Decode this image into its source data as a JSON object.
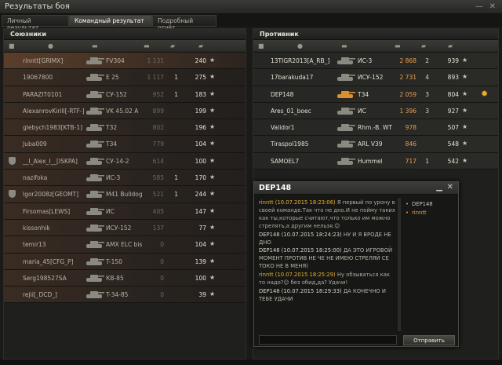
{
  "window": {
    "title": "Результаты боя",
    "min_symbol": "—",
    "close_symbol": "✕"
  },
  "tabs": [
    {
      "label": "Личный результат",
      "active": false
    },
    {
      "label": "Командный результат",
      "active": true
    },
    {
      "label": "Подробный отчёт",
      "active": false
    }
  ],
  "allies": {
    "title": "Союзники",
    "rows": [
      {
        "player": "rinntt[GRIMX]",
        "tank": "FV304",
        "damage": "1 131",
        "frags": "",
        "xp": "240",
        "highlight": true
      },
      {
        "player": "19067800",
        "tank": "E 25",
        "damage": "1 117",
        "frags": "1",
        "xp": "275"
      },
      {
        "player": "PARAZIT0101",
        "tank": "СУ-152",
        "damage": "952",
        "frags": "1",
        "xp": "183"
      },
      {
        "player": "AlexanrovKirill[-RTF-]",
        "tank": "VK 45.02 A",
        "damage": "899",
        "frags": "",
        "xp": "199"
      },
      {
        "player": "glebych1983[KTB-1]",
        "tank": "T32",
        "damage": "802",
        "frags": "",
        "xp": "196"
      },
      {
        "player": "Juba009",
        "tank": "T34",
        "damage": "779",
        "frags": "",
        "xp": "104"
      },
      {
        "player": "__I_Alex_I__[ISKPA]",
        "tank": "СУ-14-2",
        "damage": "614",
        "frags": "",
        "xp": "100",
        "clan_icon": true
      },
      {
        "player": "nazifoka",
        "tank": "ИС-3",
        "damage": "585",
        "frags": "1",
        "xp": "170"
      },
      {
        "player": "Igor2008z[GEOMT]",
        "tank": "M41 Bulldog",
        "damage": "521",
        "frags": "1",
        "xp": "244",
        "clan_icon": true
      },
      {
        "player": "Firsomas[LEWS]",
        "tank": "ИС",
        "damage": "405",
        "frags": "",
        "xp": "147"
      },
      {
        "player": "kissonhik",
        "tank": "ИСУ-152",
        "damage": "137",
        "frags": "",
        "xp": "77"
      },
      {
        "player": "temir13",
        "tank": "AMX ELC bis",
        "damage": "0",
        "frags": "",
        "xp": "104"
      },
      {
        "player": "maria_45[CFG_P]",
        "tank": "T-150",
        "damage": "0",
        "frags": "",
        "xp": "139"
      },
      {
        "player": "Serg198527SA",
        "tank": "КВ-85",
        "damage": "0",
        "frags": "",
        "xp": "100"
      },
      {
        "player": "rejii[_DCD_]",
        "tank": "T-34-85",
        "damage": "0",
        "frags": "",
        "xp": "39"
      }
    ]
  },
  "enemies": {
    "title": "Противник",
    "rows": [
      {
        "player": "13TIGR2013[A_RB_]",
        "tank": "ИС-3",
        "damage": "2 868",
        "frags": "2",
        "xp": "939"
      },
      {
        "player": "17barakuda17",
        "tank": "ИСУ-152",
        "damage": "2 731",
        "frags": "4",
        "xp": "893"
      },
      {
        "player": "DEP148",
        "tank": "T34",
        "damage": "2 059",
        "frags": "3",
        "xp": "804",
        "medal": true
      },
      {
        "player": "Ares_01_boec",
        "tank": "ИС",
        "damage": "1 396",
        "frags": "3",
        "xp": "927"
      },
      {
        "player": "Validor1",
        "tank": "Rhm.-B. WT",
        "damage": "978",
        "frags": "",
        "xp": "507"
      },
      {
        "player": "Tiraspol1985",
        "tank": "ARL V39",
        "damage": "846",
        "frags": "",
        "xp": "548"
      },
      {
        "player": "SAMOEL7",
        "tank": "Hummel",
        "damage": "717",
        "frags": "1",
        "xp": "542"
      }
    ]
  },
  "chat": {
    "title": "DEP148",
    "messages": [
      {
        "author": "rinntt (10.07.2015 18:23:06)",
        "text": "Я первый по урону в своей команде.Так что не дно.И не пойму таких как ты,которые считают,что только им можно стрелять,а другим нельзя.☺",
        "mine": true
      },
      {
        "author": "DEP148 (10.07.2015 18:24:23)",
        "text": "НУ И Я ВРОДЕ НЕ ДНО"
      },
      {
        "author": "DEP148 (10.07.2015 18:25:00)",
        "text": "ДА ЭТО ИГРОВОЙ МОМЕНТ ПРОТИВ НЕ ЧЕ НЕ ИМЕЮ СТРЕЛЯЙ СЕ ТОКО НЕ В МЕНЯ)"
      },
      {
        "author": "rinntt (10.07.2015 18:25:29)",
        "text": "Ну обзываться как то надо?☺ без обид,да? Удачи!",
        "mine": true
      },
      {
        "author": "DEP148 (10.07.2015 18:29:33)",
        "text": "ДА КОНЕЧНО И ТЕБЕ УДАЧИ"
      }
    ],
    "users": [
      "DEP148",
      "rinntt"
    ],
    "send_label": "Отправить",
    "input_value": ""
  },
  "colors": {
    "accent": "#e8b030",
    "enemy_damage": "#e8a050"
  },
  "icons": {
    "clan": "clan-shield-icon",
    "player": "person-icon",
    "tank": "tank-icon",
    "damage": "gun-icon",
    "frags": "tank-destroyed-icon",
    "star": "star-icon",
    "medal": "sun-medal-icon"
  }
}
